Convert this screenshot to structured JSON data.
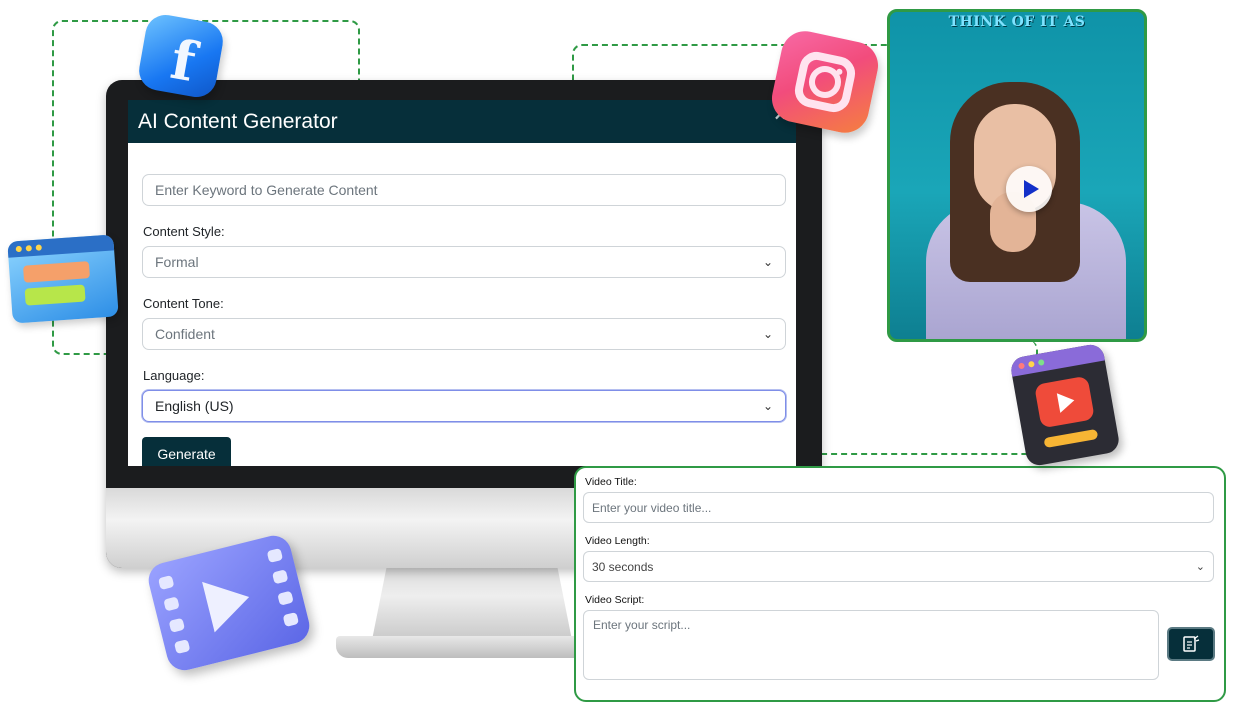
{
  "app": {
    "title": "AI Content Generator",
    "close_symbol": "×"
  },
  "keyword": {
    "placeholder": "Enter Keyword to Generate Content"
  },
  "content_style": {
    "label": "Content Style:",
    "selected": "Formal"
  },
  "content_tone": {
    "label": "Content Tone:",
    "selected": "Confident"
  },
  "language": {
    "label": "Language:",
    "selected": "English (US)"
  },
  "generate_button": {
    "label": "Generate"
  },
  "video_preview": {
    "caption": "THINK OF IT AS"
  },
  "video_form": {
    "title_label": "Video Title:",
    "title_placeholder": "Enter your video title...",
    "length_label": "Video Length:",
    "length_selected": "30 seconds",
    "script_label": "Video Script:",
    "script_placeholder": "Enter your script..."
  },
  "icons": {
    "facebook": "facebook-icon",
    "instagram": "instagram-icon",
    "window": "browser-window-icon",
    "video_player": "video-player-icon",
    "film": "film-play-icon",
    "chevron": "chevron-down-icon",
    "generate_script": "generate-script-icon"
  },
  "colors": {
    "header_bg": "#062f3a",
    "accent_green": "#2f9a45",
    "focus_blue": "#7f8ee8"
  }
}
